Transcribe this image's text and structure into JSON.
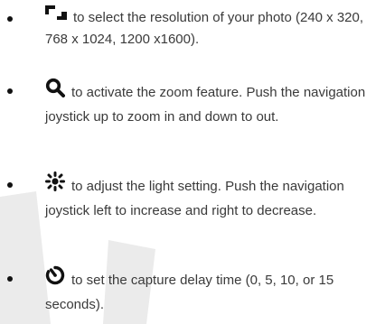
{
  "items": [
    {
      "icon": "resolution-icon",
      "text": "to select the resolution of your photo (240 x 320, 768 x 1024, 1200 x1600)."
    },
    {
      "icon": "zoom-magnifier-icon",
      "text": "to activate the zoom feature. Push the navigation joystick up to zoom in and down to out."
    },
    {
      "icon": "light-setting-icon",
      "text": "to adjust the light setting. Push the navigation joystick left to increase and right to decrease."
    },
    {
      "icon": "timer-icon",
      "text": "to set the capture delay time (0, 5, 10, or 15 seconds)."
    }
  ],
  "colors": {
    "text": "#3a3a3a",
    "icon": "#111111",
    "watermark": "#ebebeb"
  }
}
